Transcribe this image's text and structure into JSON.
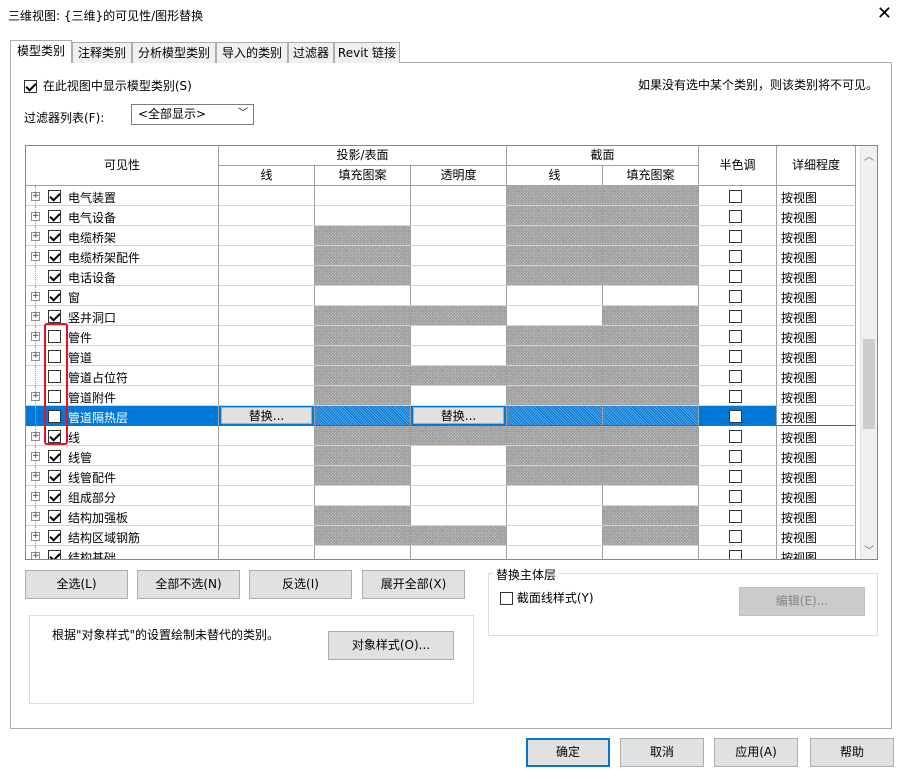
{
  "window": {
    "title": "三维视图: {三维}的可见性/图形替换"
  },
  "tabs": [
    {
      "label": "模型类别",
      "active": true
    },
    {
      "label": "注释类别"
    },
    {
      "label": "分析模型类别"
    },
    {
      "label": "导入的类别"
    },
    {
      "label": "过滤器"
    },
    {
      "label": "Revit 链接"
    }
  ],
  "show_model_categories": {
    "label": "在此视图中显示模型类别(S)",
    "checked": true
  },
  "hint_text": "如果没有选中某个类别，则该类别将不可见。",
  "filter_list": {
    "label": "过滤器列表(F):",
    "value": "<全部显示>"
  },
  "grid_headers": {
    "visibility": "可见性",
    "projection_surface": "投影/表面",
    "section": "截面",
    "halftone": "半色调",
    "detail_level": "详细程度",
    "line": "线",
    "fill_pattern": "填充图案",
    "transparency": "透明度",
    "section_line": "线",
    "section_fill": "填充图案"
  },
  "rows": [
    {
      "name": "电气装置",
      "checked": true,
      "expander": true,
      "detail": "按视图",
      "proj": [
        0,
        0,
        0
      ],
      "sect": [
        1,
        1
      ]
    },
    {
      "name": "电气设备",
      "checked": true,
      "expander": true,
      "detail": "按视图",
      "proj": [
        0,
        0,
        0
      ],
      "sect": [
        1,
        1
      ]
    },
    {
      "name": "电缆桥架",
      "checked": true,
      "expander": true,
      "detail": "按视图",
      "proj": [
        0,
        1,
        0
      ],
      "sect": [
        1,
        1
      ]
    },
    {
      "name": "电缆桥架配件",
      "checked": true,
      "expander": true,
      "detail": "按视图",
      "proj": [
        0,
        1,
        0
      ],
      "sect": [
        1,
        1
      ]
    },
    {
      "name": "电话设备",
      "checked": true,
      "expander": false,
      "detail": "按视图",
      "proj": [
        0,
        1,
        0
      ],
      "sect": [
        1,
        1
      ]
    },
    {
      "name": "窗",
      "checked": true,
      "expander": true,
      "detail": "按视图",
      "proj": [
        0,
        0,
        0
      ],
      "sect": [
        0,
        0
      ]
    },
    {
      "name": "竖井洞口",
      "checked": true,
      "expander": true,
      "detail": "按视图",
      "proj": [
        0,
        1,
        1
      ],
      "sect": [
        0,
        1
      ]
    },
    {
      "name": "管件",
      "checked": false,
      "expander": true,
      "detail": "按视图",
      "proj": [
        0,
        1,
        0
      ],
      "sect": [
        1,
        1
      ]
    },
    {
      "name": "管道",
      "checked": false,
      "expander": true,
      "detail": "按视图",
      "proj": [
        0,
        1,
        0
      ],
      "sect": [
        1,
        1
      ]
    },
    {
      "name": "管道占位符",
      "checked": false,
      "expander": false,
      "detail": "按视图",
      "proj": [
        0,
        1,
        1
      ],
      "sect": [
        1,
        1
      ]
    },
    {
      "name": "管道附件",
      "checked": false,
      "expander": true,
      "detail": "按视图",
      "proj": [
        0,
        1,
        0
      ],
      "sect": [
        1,
        1
      ]
    },
    {
      "name": "管道隔热层",
      "checked": false,
      "expander": false,
      "detail": "按视图",
      "proj": [
        0,
        1,
        0
      ],
      "sect": [
        1,
        1
      ],
      "selected": true,
      "line_override": "替换...",
      "transparency_override": "替换..."
    },
    {
      "name": "线",
      "checked": true,
      "expander": true,
      "detail": "按视图",
      "proj": [
        0,
        1,
        1
      ],
      "sect": [
        1,
        1
      ]
    },
    {
      "name": "线管",
      "checked": true,
      "expander": true,
      "detail": "按视图",
      "proj": [
        0,
        1,
        0
      ],
      "sect": [
        1,
        1
      ]
    },
    {
      "name": "线管配件",
      "checked": true,
      "expander": true,
      "detail": "按视图",
      "proj": [
        0,
        1,
        0
      ],
      "sect": [
        1,
        1
      ]
    },
    {
      "name": "组成部分",
      "checked": true,
      "expander": true,
      "detail": "按视图",
      "proj": [
        0,
        0,
        0
      ],
      "sect": [
        0,
        0
      ]
    },
    {
      "name": "结构加强板",
      "checked": true,
      "expander": true,
      "detail": "按视图",
      "proj": [
        0,
        1,
        0
      ],
      "sect": [
        0,
        1
      ]
    },
    {
      "name": "结构区域钢筋",
      "checked": true,
      "expander": true,
      "detail": "按视图",
      "proj": [
        0,
        1,
        1
      ],
      "sect": [
        0,
        1
      ]
    },
    {
      "name": "结构基础",
      "checked": true,
      "expander": true,
      "detail": "按视图",
      "proj": [
        0,
        0,
        0
      ],
      "sect": [
        0,
        0
      ]
    }
  ],
  "buttons": {
    "select_all": "全选(L)",
    "select_none": "全部不选(N)",
    "invert": "反选(I)",
    "expand_all": "展开全部(X)",
    "object_styles": "对象样式(O)...",
    "edit": "编辑(E)...",
    "ok": "确定",
    "cancel": "取消",
    "apply": "应用(A)",
    "help": "帮助"
  },
  "object_styles_note": "根据\"对象样式\"的设置绘制未替代的类别。",
  "host_layers": {
    "title": "替换主体层",
    "cut_line_styles": "截面线样式(Y)",
    "checked": false
  }
}
